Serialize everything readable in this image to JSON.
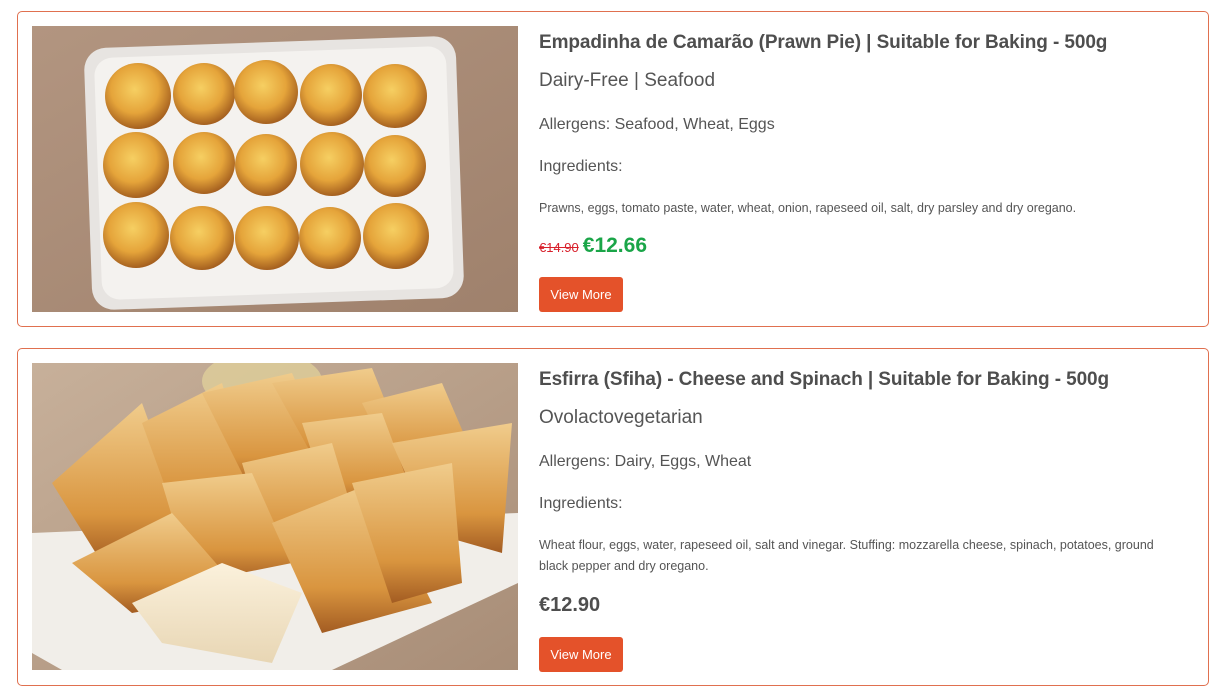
{
  "products": [
    {
      "title": "Empadinha de Camarão (Prawn Pie) | Suitable for Baking - 500g",
      "diet": "Dairy-Free | Seafood",
      "allergens": "Allergens: Seafood, Wheat, Eggs",
      "ingredients_label": "Ingredients:",
      "ingredients": "Prawns, eggs, tomato paste, water, wheat, onion, rapeseed oil, salt, dry parsley and dry oregano.",
      "old_price": "€14.90",
      "price": "€12.66",
      "button_label": "View More"
    },
    {
      "title": "Esfirra (Sfiha) - Cheese and Spinach | Suitable for Baking - 500g",
      "diet": "Ovolactovegetarian",
      "allergens": "Allergens: Dairy, Eggs, Wheat",
      "ingredients_label": "Ingredients:",
      "ingredients": "Wheat flour, eggs, water, rapeseed oil, salt and vinegar. Stuffing: mozzarella cheese, spinach, potatoes, ground black pepper and dry oregano.",
      "price": "€12.90",
      "button_label": "View More"
    }
  ],
  "colors": {
    "card_border": "#e0704f",
    "button_bg": "#e4522a",
    "sale_price": "#1aa548",
    "old_price": "#d8202b"
  }
}
